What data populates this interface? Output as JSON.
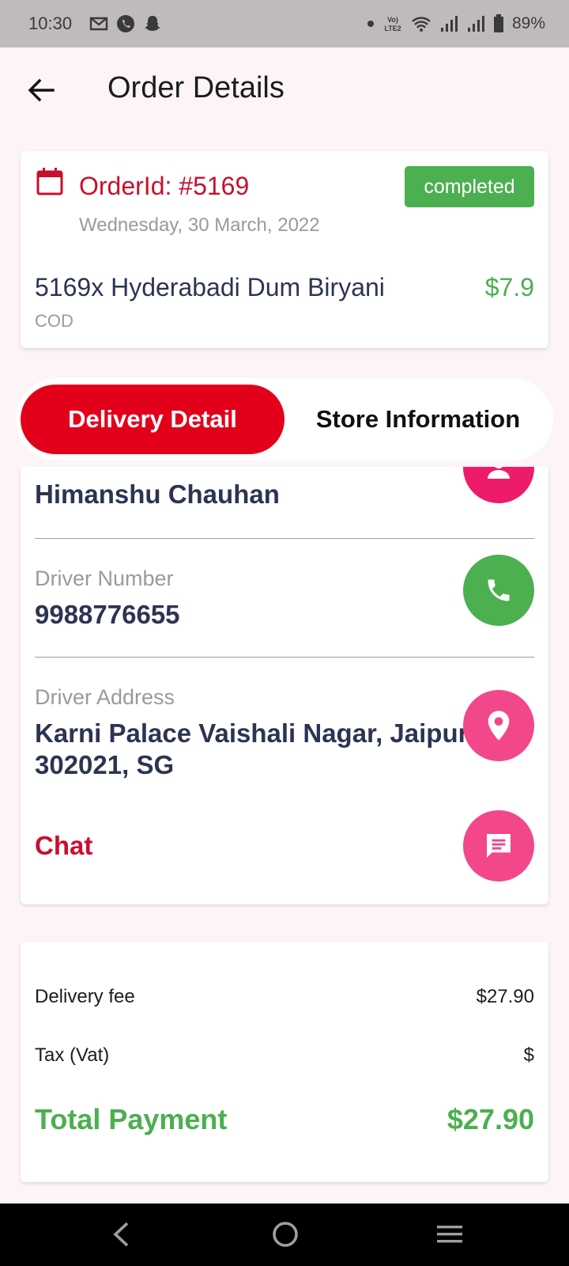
{
  "status_bar": {
    "time": "10:30",
    "battery": "89%",
    "left_icons": [
      "gmail-icon",
      "phone-icon",
      "snapchat-icon"
    ],
    "right_icons": [
      "dot-icon",
      "volte-icon",
      "wifi-icon",
      "signal-icon",
      "signal-icon",
      "battery-icon"
    ]
  },
  "header": {
    "title": "Order Details"
  },
  "order": {
    "id_label": "OrderId: #5169",
    "date": "Wednesday, 30 March, 2022",
    "status": "completed",
    "item": "5169x Hyderabadi Dum Biryani",
    "price": "$7.9",
    "payment_method": "COD"
  },
  "tabs": [
    {
      "label": "Delivery Detail",
      "active": true
    },
    {
      "label": "Store Information",
      "active": false
    }
  ],
  "delivery": {
    "driver_name": "Himanshu Chauhan",
    "driver_number_label": "Driver Number",
    "driver_number": "9988776655",
    "driver_address_label": "Driver Address",
    "driver_address_line1": "Karni Palace Vaishali Nagar, Jaipur",
    "driver_address_line2": "302021, SG",
    "chat_label": "Chat"
  },
  "summary": {
    "delivery_fee_label": "Delivery fee",
    "delivery_fee": "$27.90",
    "tax_label": "Tax (Vat)",
    "tax": "$",
    "total_label": "Total Payment",
    "total": "$27.90"
  },
  "colors": {
    "brand_red": "#e3001b",
    "text_red": "#c8102e",
    "green": "#4caf50",
    "pink": "#ec1c6a",
    "pink_light": "#f2478a",
    "navy_text": "#2d3452"
  }
}
